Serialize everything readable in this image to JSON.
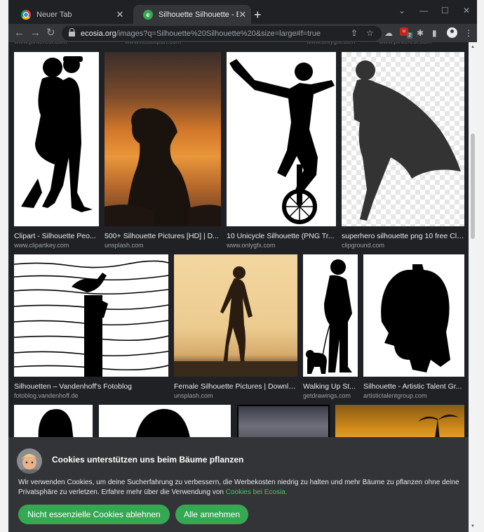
{
  "browser": {
    "tabs": [
      {
        "title": "Neuer Tab",
        "active": false
      },
      {
        "title": "Silhouette Silhouette - Ecosia - Im",
        "active": true
      }
    ],
    "new_tab_glyph": "+",
    "window_controls": [
      "⌄",
      "—",
      "☐",
      "✕"
    ],
    "url_host": "ecosia.org",
    "url_path": "/images?q=Silhouette%20Silhouette%20&size=large#f=true",
    "extension_badge": "2"
  },
  "results": {
    "row1": [
      {
        "caption": "Clipart - Silhouette Peo...",
        "source": "www.clipartkey.com"
      },
      {
        "caption": "500+ Silhouette Pictures [HD] | D...",
        "source": "unsplash.com"
      },
      {
        "caption": "10 Unicycle Silhouette (PNG Tr...",
        "source": "www.onlygfx.com"
      },
      {
        "caption": "superhero silhouette png 10 free Cli...",
        "source": "clipground.com"
      }
    ],
    "row2": [
      {
        "caption": "Silhouetten – Vandenhoff's Fotoblog",
        "source": "fotoblog.vandenhoff.de"
      },
      {
        "caption": "Female Silhouette Pictures | Downlo...",
        "source": "unsplash.com"
      },
      {
        "caption": "Walking Up St...",
        "source": "getdrawings.com"
      },
      {
        "caption": "Silhouette - Artistic Talent Gr...",
        "source": "artistictalentgroup.com"
      }
    ]
  },
  "cookie_banner": {
    "heading": "Cookies unterstützen uns beim Bäume pflanzen",
    "body": "Wir verwenden Cookies, um deine Sucherfahrung zu verbessern, die Werbekosten niedrig zu halten und mehr Bäume zu pflanzen ohne deine Privatsphäre zu verletzen. Erfahre mehr über die Verwendung von ",
    "link": "Cookies bei Ecosia.",
    "reject_label": "Nicht essenzielle Cookies ablehnen",
    "accept_label": "Alle annehmen"
  },
  "colors": {
    "brand_green": "#36a853",
    "link_green": "#4fc46a",
    "background": "#202124"
  }
}
